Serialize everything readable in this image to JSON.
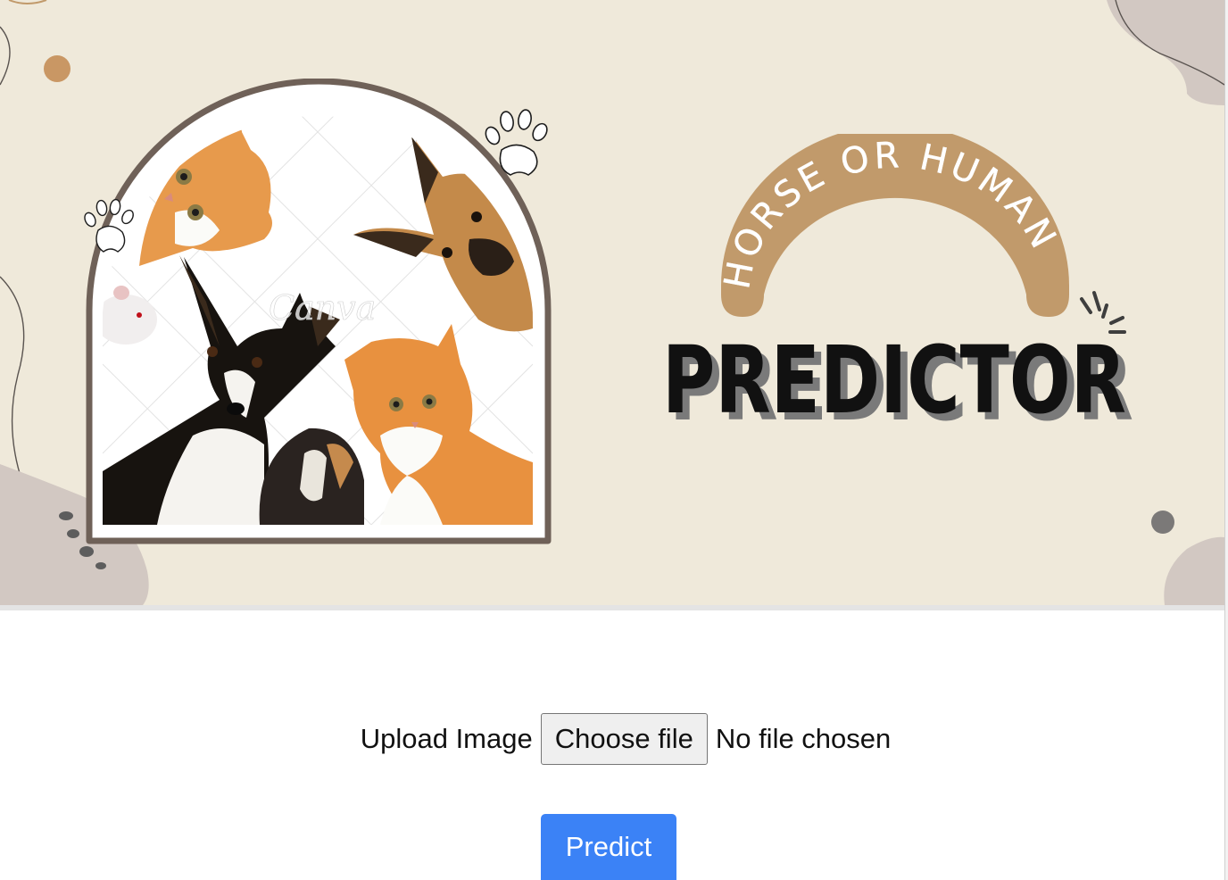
{
  "banner": {
    "logo_arc_text": "HORSE OR HUMAN",
    "logo_main_text": "PREDICTOR",
    "watermark_text": "Canva",
    "colors": {
      "background": "#efe9da",
      "arc": "#c19a6b",
      "frame": "#6f6158",
      "blob": "#d2c8c2",
      "logo_text": "#111111"
    }
  },
  "form": {
    "upload_label": "Upload Image",
    "choose_file_label": "Choose file",
    "file_status": "No file chosen",
    "predict_label": "Predict",
    "predict_color": "#3b82f6"
  }
}
